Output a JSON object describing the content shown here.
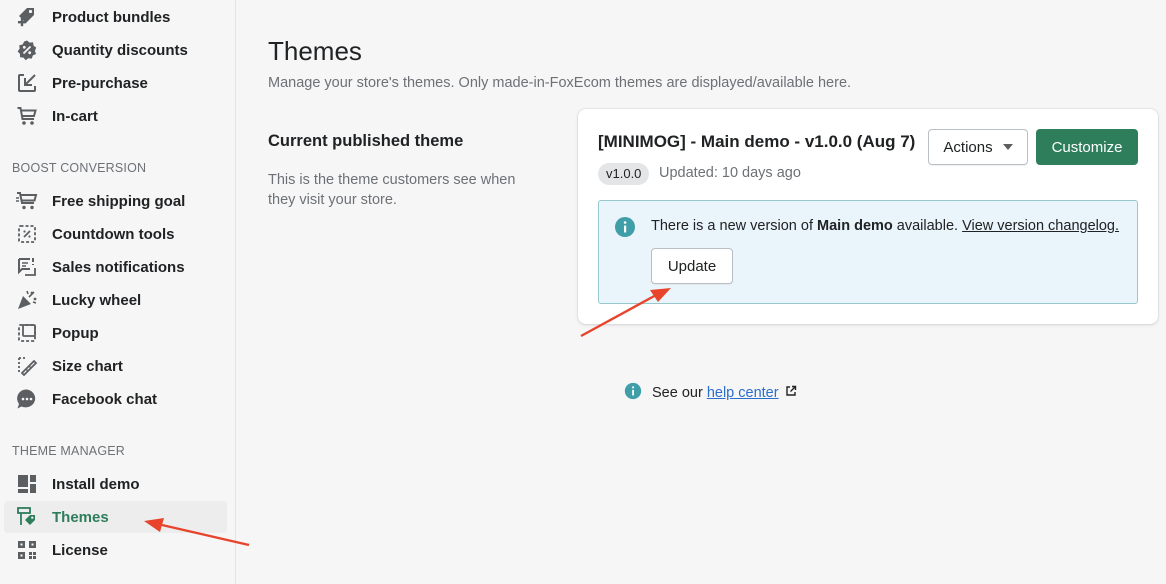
{
  "sidebar": {
    "top_items": [
      {
        "label": "Product bundles",
        "icon": "tag-plus-icon"
      },
      {
        "label": "Quantity discounts",
        "icon": "discount-badge-icon"
      },
      {
        "label": "Pre-purchase",
        "icon": "import-icon"
      },
      {
        "label": "In-cart",
        "icon": "cart-icon"
      }
    ],
    "boost_heading": "BOOST CONVERSION",
    "boost_items": [
      {
        "label": "Free shipping goal",
        "icon": "shipping-cart-icon"
      },
      {
        "label": "Countdown tools",
        "icon": "countdown-icon"
      },
      {
        "label": "Sales notifications",
        "icon": "notification-icon"
      },
      {
        "label": "Lucky wheel",
        "icon": "confetti-icon"
      },
      {
        "label": "Popup",
        "icon": "popup-icon"
      },
      {
        "label": "Size chart",
        "icon": "ruler-icon"
      },
      {
        "label": "Facebook chat",
        "icon": "chat-icon"
      }
    ],
    "theme_heading": "THEME MANAGER",
    "theme_items": [
      {
        "label": "Install demo",
        "icon": "layout-icon"
      },
      {
        "label": "Themes",
        "icon": "theme-tag-icon",
        "active": true
      },
      {
        "label": "License",
        "icon": "qr-grid-icon"
      }
    ]
  },
  "main": {
    "title": "Themes",
    "subtitle": "Manage your store's themes. Only made-in-FoxEcom themes are displayed/available here.",
    "section_title": "Current published theme",
    "section_desc": "This is the theme customers see when they visit your store.",
    "card": {
      "theme_name": "[MINIMOG] - Main demo - v1.0.0 (Aug 7)",
      "version": "v1.0.0",
      "updated": "Updated: 10 days ago",
      "actions_label": "Actions",
      "customize_label": "Customize",
      "banner": {
        "text_before": "There is a new version of ",
        "text_bold": "Main demo",
        "text_after": " available. ",
        "link": "View version changelog.",
        "update_label": "Update"
      }
    },
    "help": {
      "prefix": "See our",
      "link": "help center"
    }
  },
  "colors": {
    "accent": "#2e7d5b",
    "link": "#2c6ecb",
    "banner_bg": "#eaf4fb",
    "arrow": "#e8442c"
  }
}
